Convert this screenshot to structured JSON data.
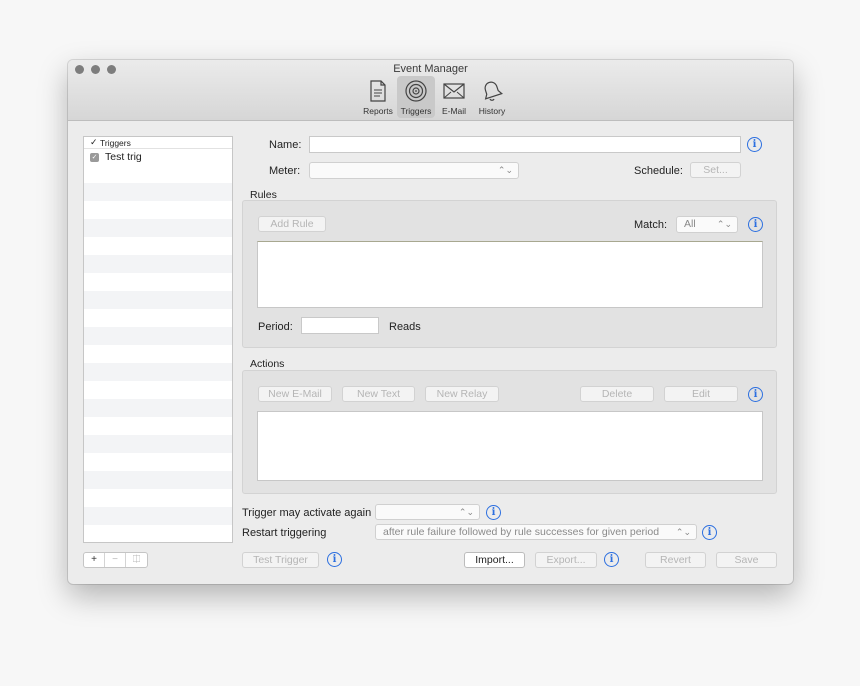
{
  "window": {
    "title": "Event Manager"
  },
  "toolbar": {
    "items": [
      {
        "label": "Reports",
        "icon": "reports-icon",
        "active": false
      },
      {
        "label": "Triggers",
        "icon": "target-icon",
        "active": true
      },
      {
        "label": "E-Mail",
        "icon": "envelope-icon",
        "active": false
      },
      {
        "label": "History",
        "icon": "bell-icon",
        "active": false
      }
    ]
  },
  "sidebar": {
    "header": {
      "check": "✓",
      "label": "Triggers"
    },
    "items": [
      {
        "label": "Test trig",
        "checked": true
      }
    ],
    "buttons": {
      "add": "+",
      "remove": "−",
      "options": "⎅"
    }
  },
  "form": {
    "name_label": "Name:",
    "name_value": "",
    "meter_label": "Meter:",
    "meter_value": "",
    "schedule_label": "Schedule:",
    "schedule_button": "Set..."
  },
  "rules": {
    "title": "Rules",
    "add_rule": "Add Rule",
    "match_label": "Match:",
    "match_value": "All",
    "period_label": "Period:",
    "period_value": "",
    "reads_label": "Reads"
  },
  "actions": {
    "title": "Actions",
    "new_email": "New E-Mail",
    "new_text": "New Text",
    "new_relay": "New Relay",
    "delete": "Delete",
    "edit": "Edit"
  },
  "options": {
    "activate_label": "Trigger may activate again",
    "activate_value": "",
    "restart_label": "Restart triggering",
    "restart_value": "after rule failure followed by rule successes for given period"
  },
  "footer": {
    "test_trigger": "Test Trigger",
    "import": "Import...",
    "export": "Export...",
    "revert": "Revert",
    "save": "Save"
  },
  "info_glyph": "i"
}
